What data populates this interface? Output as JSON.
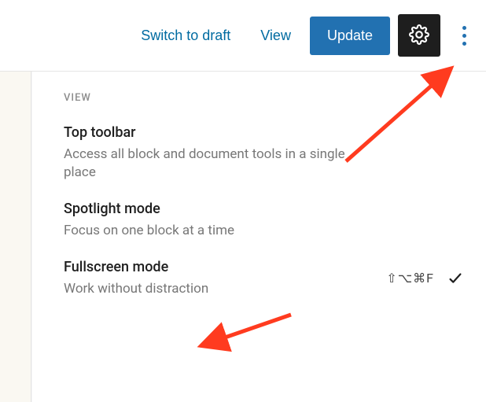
{
  "toolbar": {
    "switch_draft_label": "Switch to draft",
    "view_label": "View",
    "update_label": "Update"
  },
  "menu": {
    "section_label": "VIEW",
    "items": [
      {
        "title": "Top toolbar",
        "desc": "Access all block and document tools in a single place"
      },
      {
        "title": "Spotlight mode",
        "desc": "Focus on one block at a time"
      },
      {
        "title": "Fullscreen mode",
        "desc": "Work without distraction",
        "shortcut": "⇧⌥⌘F",
        "checked": true
      }
    ]
  }
}
